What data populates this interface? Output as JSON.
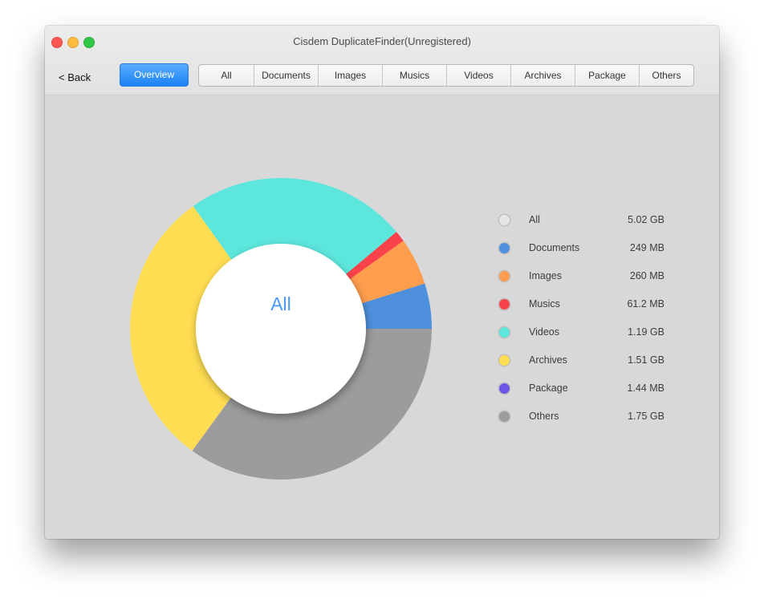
{
  "window": {
    "title": "Cisdem DuplicateFinder(Unregistered)"
  },
  "toolbar": {
    "back_label": "< Back",
    "overview_label": "Overview",
    "tabs": [
      {
        "label": "All"
      },
      {
        "label": "Documents"
      },
      {
        "label": "Images"
      },
      {
        "label": "Musics"
      },
      {
        "label": "Videos"
      },
      {
        "label": "Archives"
      },
      {
        "label": "Package"
      },
      {
        "label": "Others"
      }
    ]
  },
  "donut": {
    "center_label": "All"
  },
  "legend": [
    {
      "label": "All",
      "value": "5.02 GB",
      "color": "#e6e6e6"
    },
    {
      "label": "Documents",
      "value": "249 MB",
      "color": "#4f90dc"
    },
    {
      "label": "Images",
      "value": "260 MB",
      "color": "#fd9d4e"
    },
    {
      "label": "Musics",
      "value": "61.2 MB",
      "color": "#f9424a"
    },
    {
      "label": "Videos",
      "value": "1.19 GB",
      "color": "#5ce6dc"
    },
    {
      "label": "Archives",
      "value": "1.51 GB",
      "color": "#fedd52"
    },
    {
      "label": "Package",
      "value": "1.44 MB",
      "color": "#6e55e8"
    },
    {
      "label": "Others",
      "value": "1.75 GB",
      "color": "#9c9c9c"
    }
  ],
  "chart_data": {
    "type": "pie",
    "variant": "donut",
    "title": "All",
    "unit": "MB",
    "direction": "counterclockwise from 3 o'clock",
    "slices": [
      {
        "name": "Documents",
        "value": 249,
        "display": "249 MB",
        "color": "#4f90dc"
      },
      {
        "name": "Images",
        "value": 260,
        "display": "260 MB",
        "color": "#fd9d4e"
      },
      {
        "name": "Musics",
        "value": 61.2,
        "display": "61.2 MB",
        "color": "#f9424a"
      },
      {
        "name": "Videos",
        "value": 1218.6,
        "display": "1.19 GB",
        "color": "#5ce6dc"
      },
      {
        "name": "Archives",
        "value": 1546.2,
        "display": "1.51 GB",
        "color": "#fedd52"
      },
      {
        "name": "Package",
        "value": 1.44,
        "display": "1.44 MB",
        "color": "#6e55e8"
      },
      {
        "name": "Others",
        "value": 1792,
        "display": "1.75 GB",
        "color": "#9c9c9c"
      }
    ],
    "total_display": "5.02 GB",
    "legend_position": "right"
  }
}
